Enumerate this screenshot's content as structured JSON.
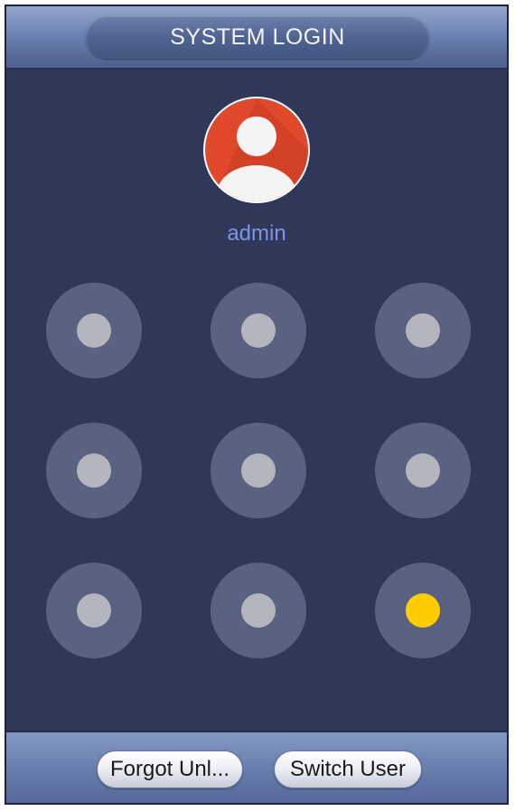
{
  "window": {
    "title": "SYSTEM LOGIN"
  },
  "user": {
    "name": "admin",
    "avatar_icon": "user-avatar-icon",
    "avatar_color": "#e0492b"
  },
  "pattern": {
    "rows": 3,
    "cols": 3,
    "active_index": 8,
    "node_color": "#5b6180",
    "core_color": "#b4b6bf",
    "active_color": "#ffcc00"
  },
  "footer": {
    "forgot_label": "Forgot Unl...",
    "switch_label": "Switch User"
  }
}
